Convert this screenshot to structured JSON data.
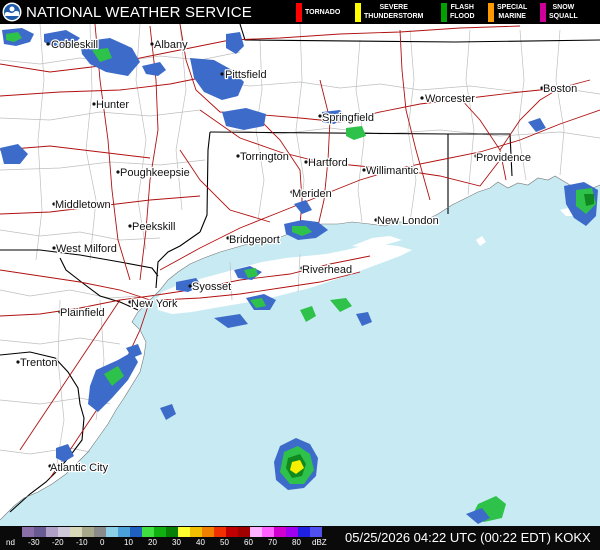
{
  "header": {
    "title": "NATIONAL WEATHER SERVICE",
    "logo_icon": "noaa-nws-logo-icon"
  },
  "legend": [
    {
      "label": "TORNADO",
      "color": "#ff0000"
    },
    {
      "label": "SEVERE\nTHUNDERSTORM",
      "color": "#ffff00"
    },
    {
      "label": "FLASH\nFLOOD",
      "color": "#00a000"
    },
    {
      "label": "SPECIAL\nMARINE",
      "color": "#ff9900"
    },
    {
      "label": "SNOW\nSQUALL",
      "color": "#cc0099"
    }
  ],
  "cities": [
    {
      "name": "Cobleskill"
    },
    {
      "name": "Albany"
    },
    {
      "name": "Pittsfield"
    },
    {
      "name": "Hunter"
    },
    {
      "name": "Springfield"
    },
    {
      "name": "Worcester"
    },
    {
      "name": "Boston"
    },
    {
      "name": "Torrington"
    },
    {
      "name": "Hartford"
    },
    {
      "name": "Providence"
    },
    {
      "name": "Poughkeepsie"
    },
    {
      "name": "Willimantic"
    },
    {
      "name": "Meriden"
    },
    {
      "name": "Middletown"
    },
    {
      "name": "Peekskill"
    },
    {
      "name": "New London"
    },
    {
      "name": "Bridgeport"
    },
    {
      "name": "West Milford"
    },
    {
      "name": "Riverhead"
    },
    {
      "name": "Syosset"
    },
    {
      "name": "New York"
    },
    {
      "name": "Plainfield"
    },
    {
      "name": "Trenton"
    },
    {
      "name": "Atlantic City"
    }
  ],
  "scale": {
    "labels": [
      "nd",
      "-30",
      "-20",
      "-10",
      "0",
      "10",
      "20",
      "30",
      "40",
      "50",
      "60",
      "70",
      "80",
      "dBZ"
    ],
    "colors": [
      "#8a6ea8",
      "#6a5a94",
      "#b0a0c8",
      "#cfc8d8",
      "#d8d8b8",
      "#a8a88a",
      "#8a8a8a",
      "#8cd0e8",
      "#4aa0d8",
      "#2060c0",
      "#40e040",
      "#10b010",
      "#088008",
      "#ffff30",
      "#f0c000",
      "#f08000",
      "#f03000",
      "#c00000",
      "#a00000",
      "#ffb0ff",
      "#ff60ff",
      "#d000d0",
      "#a000f0",
      "#2020e0",
      "#5050f0"
    ]
  },
  "timestamp": "05/25/2026 04:22 UTC (00:22 EDT) KOKX",
  "colors": {
    "ocean": "#c8ebf3",
    "land": "#ffffff",
    "state_border": "#000000",
    "county_border": "#bfbfbf",
    "highway": "#b01010",
    "radar_light_blue": "#3d6bc9",
    "radar_green": "#2ec24a",
    "radar_yellow": "#f6f000"
  }
}
